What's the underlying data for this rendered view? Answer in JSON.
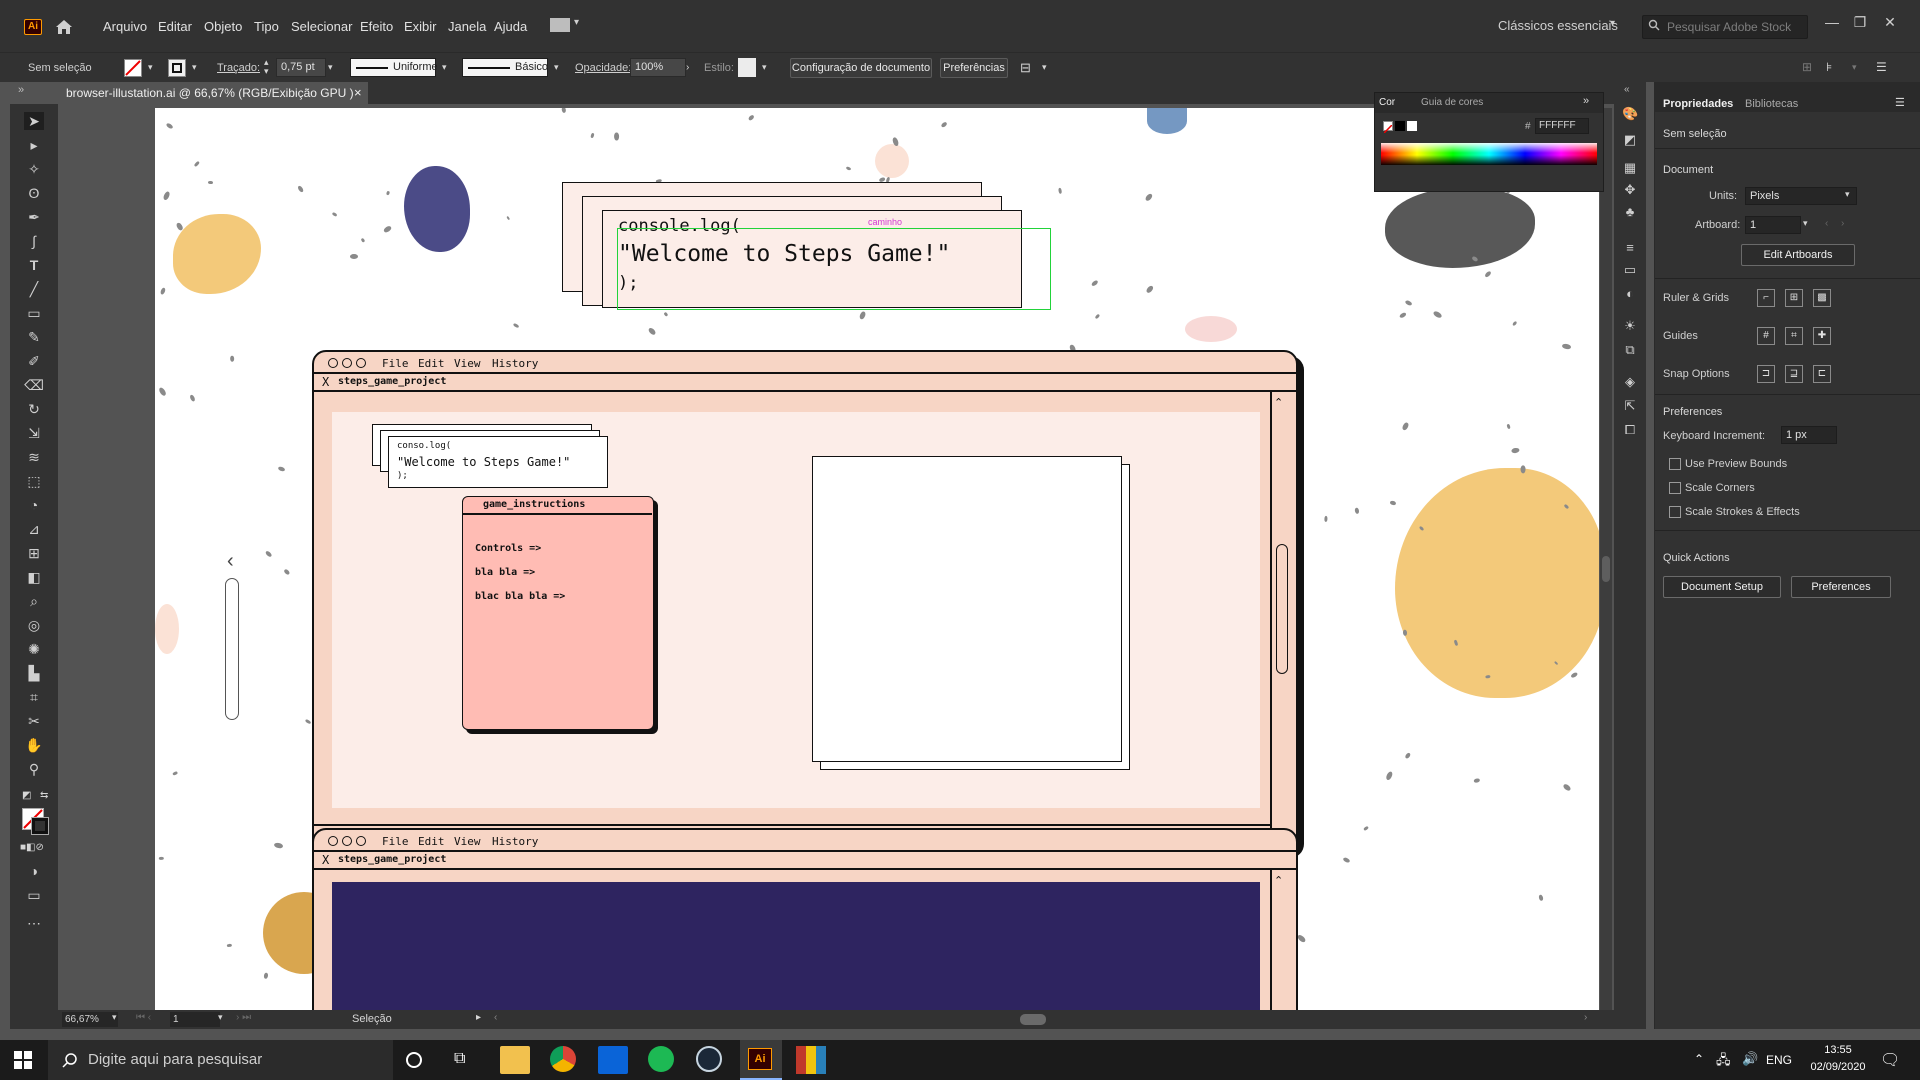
{
  "app": {
    "logo": "Ai"
  },
  "menu": [
    "Arquivo",
    "Editar",
    "Objeto",
    "Tipo",
    "Selecionar",
    "Efeito",
    "Exibir",
    "Janela",
    "Ajuda"
  ],
  "workspace": "Clássicos essenciais",
  "stock_placeholder": "Pesquisar Adobe Stock",
  "control": {
    "selection": "Sem seleção",
    "stroke_label": "Traçado:",
    "stroke_value": "0,75 pt",
    "profile": "Uniforme",
    "brush": "Básico",
    "opacity_label": "Opacidade:",
    "opacity_value": "100%",
    "style_label": "Estilo:",
    "doc_setup": "Configuração de documento",
    "prefs": "Preferências"
  },
  "tab": {
    "title": "browser-illustation.ai @ 66,67% (RGB/Exibição GPU )",
    "close": "×"
  },
  "artwork": {
    "console_line1": "console.log(",
    "console_line2": "\"Welcome to Steps Game!\"",
    "console_line3": ");",
    "path_label": "caminho",
    "menu_file": "File",
    "menu_edit": "Edit",
    "menu_view": "View",
    "menu_history": "History",
    "project_tab": "steps_game_project",
    "tab_close": "X",
    "small_line1": "conso.log(",
    "small_line2": "\"Welcome to Steps Game!\"",
    "small_line3": ");",
    "instructions_title": "game_instructions",
    "instr_1": "Controls =>",
    "instr_2": "bla bla =>",
    "instr_3": "blac bla bla =>"
  },
  "color_panel": {
    "tab_color": "Cor",
    "tab_guide": "Guia de cores",
    "hash": "#",
    "hex": "FFFFFF"
  },
  "properties": {
    "tab_props": "Propriedades",
    "tab_libs": "Bibliotecas",
    "no_selection": "Sem seleção",
    "document": "Document",
    "units_label": "Units:",
    "units_value": "Pixels",
    "artboard_label": "Artboard:",
    "artboard_value": "1",
    "edit_artboards": "Edit Artboards",
    "ruler_grids": "Ruler & Grids",
    "guides": "Guides",
    "snap_options": "Snap Options",
    "preferences": "Preferences",
    "keyboard_increment": "Keyboard Increment:",
    "keyboard_increment_value": "1 px",
    "use_preview_bounds": "Use Preview Bounds",
    "scale_corners": "Scale Corners",
    "scale_strokes": "Scale Strokes & Effects",
    "quick_actions": "Quick Actions",
    "document_setup": "Document Setup",
    "preferences_btn": "Preferences"
  },
  "status": {
    "zoom": "66,67%",
    "artboard": "1",
    "tool": "Seleção"
  },
  "taskbar": {
    "search": "Digite aqui para pesquisar",
    "lang": "ENG",
    "time": "13:55",
    "date": "02/09/2020"
  }
}
